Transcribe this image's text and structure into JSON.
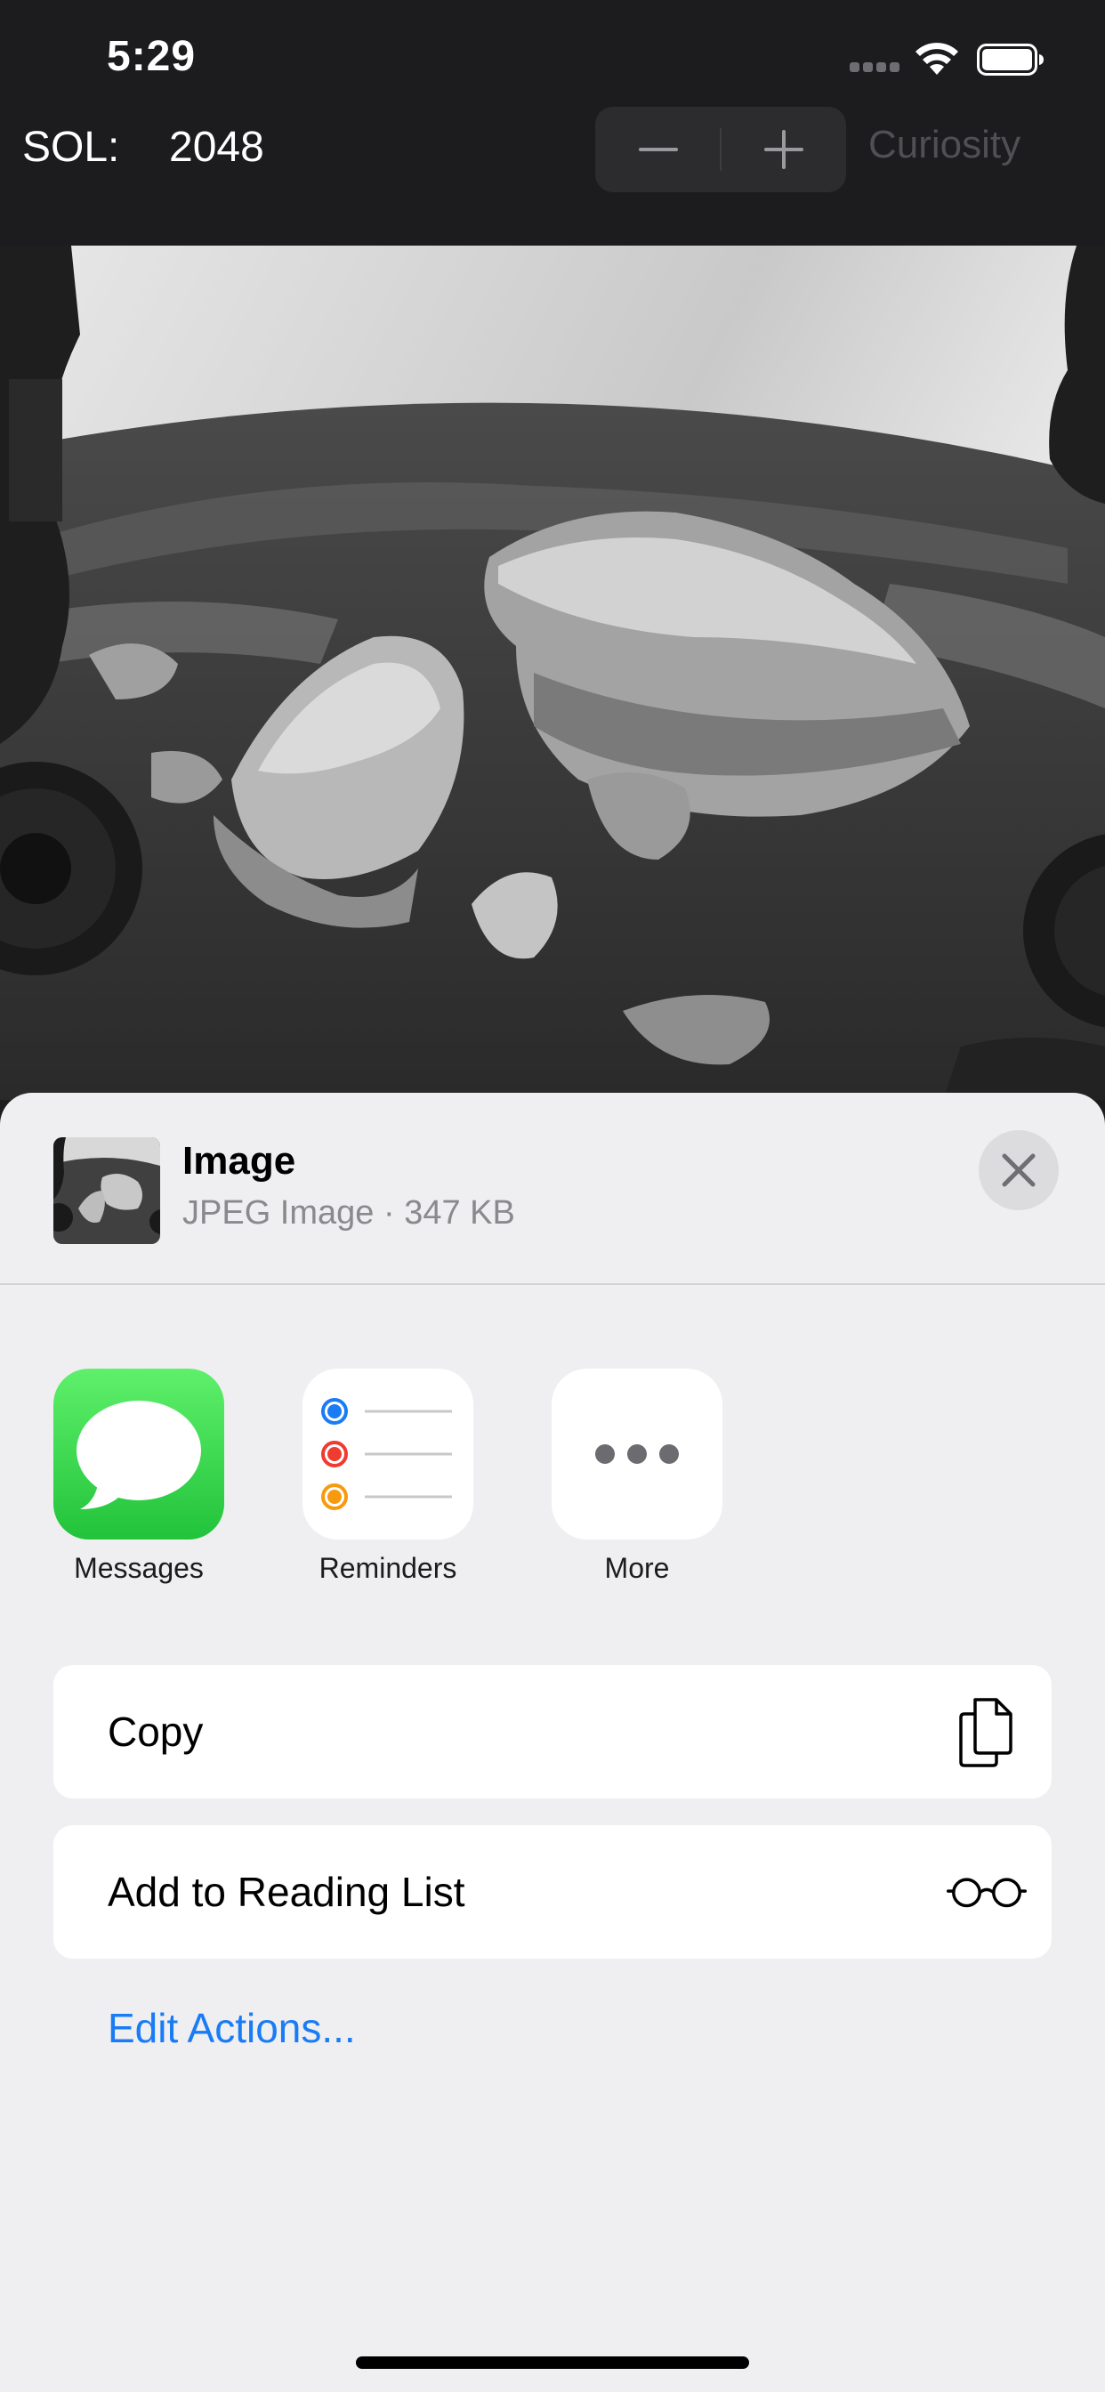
{
  "status_bar": {
    "time": "5:29"
  },
  "toolbar": {
    "sol_label": "SOL:",
    "sol_value": "2048",
    "decrement_symbol": "−",
    "increment_symbol": "+",
    "rover": "Curiosity"
  },
  "photo": {
    "description_icon": "mars-surface-photo"
  },
  "share_sheet": {
    "title": "Image",
    "subtitle": "JPEG Image · 347 KB",
    "apps": [
      {
        "label": "Messages",
        "icon": "messages-icon"
      },
      {
        "label": "Reminders",
        "icon": "reminders-icon"
      },
      {
        "label": "More",
        "icon": "more-icon"
      }
    ],
    "actions": [
      {
        "label": "Copy",
        "icon": "copy-icon"
      },
      {
        "label": "Add to Reading List",
        "icon": "glasses-icon"
      }
    ],
    "edit_actions": "Edit Actions..."
  },
  "colors": {
    "accent": "#1a7cf5",
    "toolbar_bg": "#1c1c1e",
    "sheet_bg": "#efeff1",
    "messages_green": "#21c33a"
  }
}
